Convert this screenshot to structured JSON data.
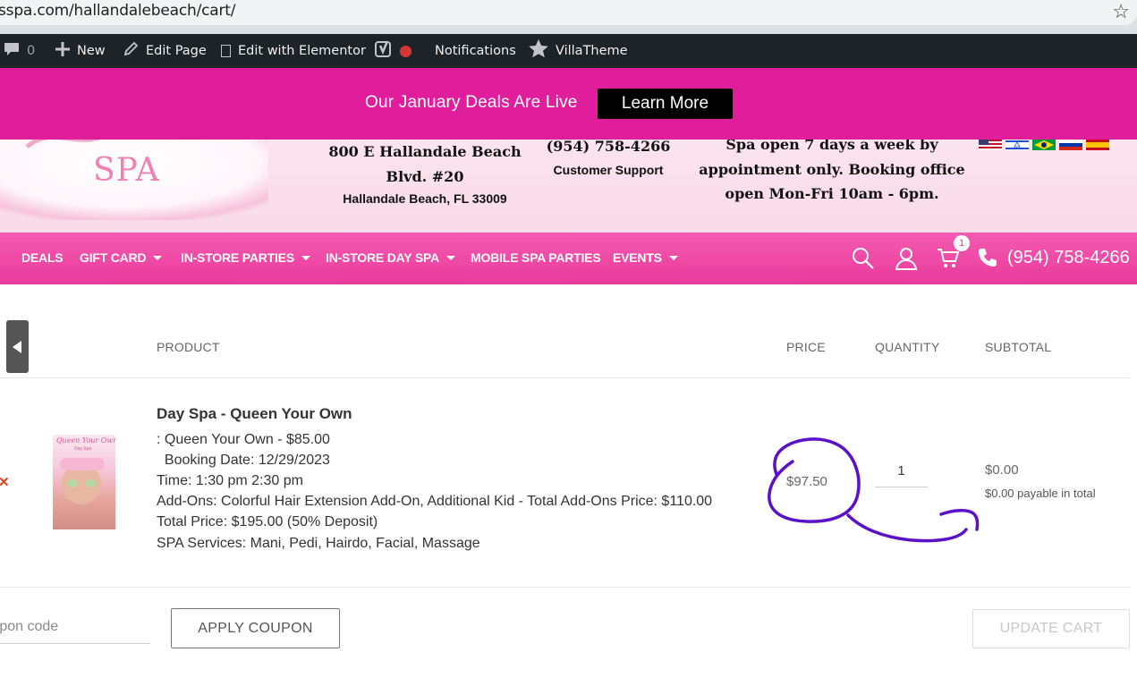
{
  "browser": {
    "url": "sspa.com/hallandalebeach/cart/",
    "bookmark_icon": "star-icon"
  },
  "admin_bar": {
    "comments_count": "0",
    "new_label": "New",
    "edit_page_label": "Edit Page",
    "edit_elementor_label": "Edit with Elementor",
    "notifications_label": "Notifications",
    "villatheme_label": "VillaTheme",
    "status_dot_color": "#d63638"
  },
  "promo": {
    "text": "Our January Deals Are Live",
    "button_label": "Learn More",
    "background_color": "#e01e9c"
  },
  "header": {
    "logo_text": "SPA",
    "address_line1": "800 E Hallandale Beach",
    "address_line2": "Blvd. #20",
    "address_line3": "Hallandale Beach, FL 33009",
    "phone": "(954) 758-4266",
    "phone_caption": "Customer Support",
    "hours_line1": "Spa open 7 days a week by",
    "hours_line2": "appointment only. Booking office",
    "hours_line3": "open Mon-Fri 10am - 6pm."
  },
  "nav": {
    "items": [
      {
        "label": "DEALS",
        "dropdown": false
      },
      {
        "label": "GIFT CARD",
        "dropdown": true
      },
      {
        "label": "IN-STORE PARTIES",
        "dropdown": true
      },
      {
        "label": "IN-STORE DAY SPA",
        "dropdown": true
      },
      {
        "label": "MOBILE SPA PARTIES",
        "dropdown": false
      },
      {
        "label": "EVENTS",
        "dropdown": true
      }
    ],
    "cart_count": "1",
    "phone": "(954) 758-4266",
    "background_color": "#ee47a6"
  },
  "cart": {
    "headers": {
      "product": "PRODUCT",
      "price": "PRICE",
      "quantity": "QUANTITY",
      "subtotal": "SUBTOTAL"
    },
    "item": {
      "name": "Day Spa - Queen Your Own",
      "thumb_title": "Queen Your Own",
      "thumb_subtitle": "Day Spa",
      "meta": [
        ": Queen Your Own - $85.00",
        "  Booking Date: 12/29/2023",
        "Time: 1:30 pm 2:30 pm",
        "Add-Ons: Colorful Hair Extension Add-On, Additional Kid - Total Add-Ons Price: $110.00",
        "Total Price: $195.00 (50% Deposit)",
        "SPA Services: Mani, Pedi, Hairdo, Facial, Massage"
      ],
      "price": "$97.50",
      "quantity": "1",
      "subtotal": "$0.00",
      "payable": "$0.00 payable in total",
      "remove_icon": "remove-x-icon"
    },
    "coupon_placeholder": "Coupon code",
    "apply_coupon_label": "APPLY COUPON",
    "update_cart_label": "UPDATE CART"
  },
  "annotation_color": "#5b10c9"
}
